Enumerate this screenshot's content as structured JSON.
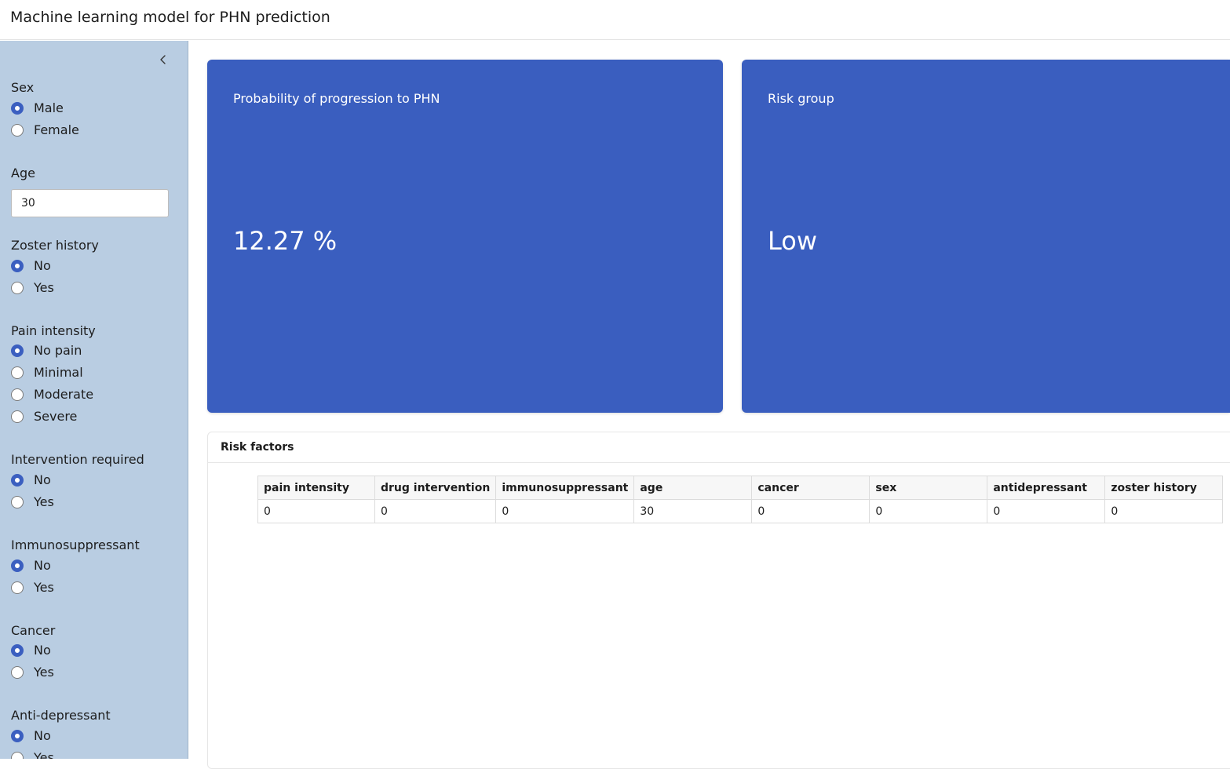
{
  "header": {
    "title": "Machine learning model for PHN prediction"
  },
  "sidebar": {
    "collapse_icon": "chevron-left-icon",
    "groups": [
      {
        "label": "Sex",
        "options": [
          "Male",
          "Female"
        ],
        "selected": "Male"
      },
      {
        "label": "Age",
        "value": "30"
      },
      {
        "label": "Zoster history",
        "options": [
          "No",
          "Yes"
        ],
        "selected": "No"
      },
      {
        "label": "Pain intensity",
        "options": [
          "No pain",
          "Minimal",
          "Moderate",
          "Severe"
        ],
        "selected": "No pain"
      },
      {
        "label": "Intervention required",
        "options": [
          "No",
          "Yes"
        ],
        "selected": "No"
      },
      {
        "label": "Immunosuppressant",
        "options": [
          "No",
          "Yes"
        ],
        "selected": "No"
      },
      {
        "label": "Cancer",
        "options": [
          "No",
          "Yes"
        ],
        "selected": "No"
      },
      {
        "label": "Anti-depressant",
        "options": [
          "No",
          "Yes"
        ],
        "selected": "No"
      }
    ]
  },
  "value_boxes": [
    {
      "title": "Probability of progression to PHN",
      "value": "12.27 %"
    },
    {
      "title": "Risk group",
      "value": "Low"
    }
  ],
  "risk_factors": {
    "title": "Risk factors",
    "columns": [
      "pain intensity",
      "drug intervention",
      "immunosuppressant",
      "age",
      "cancer",
      "sex",
      "antidepressant",
      "zoster history"
    ],
    "rows": [
      [
        "0",
        "0",
        "0",
        "30",
        "0",
        "0",
        "0",
        "0"
      ]
    ]
  },
  "colors": {
    "sidebar_bg": "#b9cde2",
    "value_box_bg": "#3a5ebf",
    "radio_checked": "#3b5fc0"
  }
}
